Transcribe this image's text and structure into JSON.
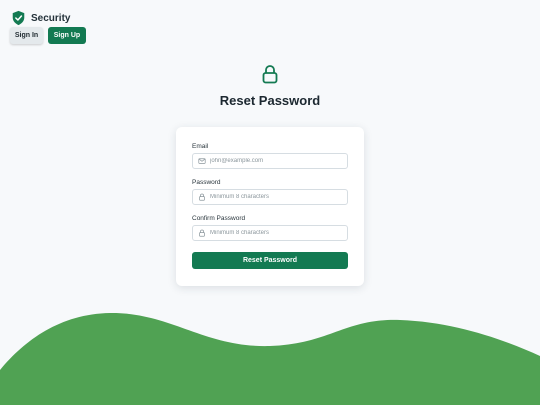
{
  "brand": {
    "name": "Security",
    "icon": "shield-check-icon"
  },
  "nav": {
    "sign_in_label": "Sign In",
    "sign_up_label": "Sign Up"
  },
  "hero": {
    "icon": "lock-icon",
    "title": "Reset Password"
  },
  "form": {
    "email": {
      "label": "Email",
      "placeholder": "john@example.com",
      "value": "",
      "icon": "mail-icon"
    },
    "password": {
      "label": "Password",
      "placeholder": "Minimum 8 characters",
      "value": "",
      "icon": "lock-icon"
    },
    "confirm_password": {
      "label": "Confirm Password",
      "placeholder": "Minimum 8 characters",
      "value": "",
      "icon": "lock-icon"
    },
    "submit_label": "Reset Password"
  },
  "colors": {
    "accent": "#137a52",
    "hill": "#50a253",
    "background": "#f7f9fb"
  }
}
